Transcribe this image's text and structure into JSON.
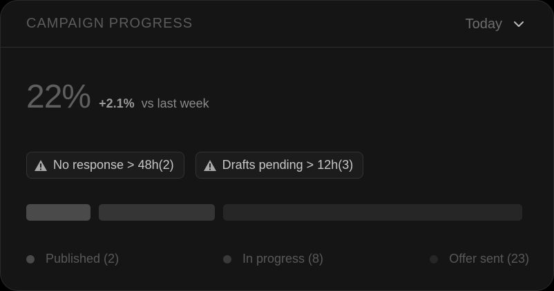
{
  "header": {
    "title": "CAMPAIGN PROGRESS",
    "period": "Today",
    "period_icon": "chevron-down-icon"
  },
  "metric": {
    "value": "22%",
    "delta": "+2.1%",
    "comparison": "vs last week"
  },
  "alerts": [
    {
      "icon": "warning-icon",
      "label": "No response > 48h(2)"
    },
    {
      "icon": "warning-icon",
      "label": "Drafts pending > 12h(3)"
    }
  ],
  "progress": {
    "segments": [
      {
        "name": "Published",
        "count": 2,
        "color": "#4a4a4a"
      },
      {
        "name": "In progress",
        "count": 8,
        "color": "#353535"
      },
      {
        "name": "Offer sent",
        "count": 23,
        "color": "#262626"
      }
    ]
  },
  "legend": [
    {
      "label": "Published (2)",
      "color": "#4a4a4a"
    },
    {
      "label": "In progress (8)",
      "color": "#3a3a3a"
    },
    {
      "label": "Offer sent (23)",
      "color": "#262626"
    }
  ]
}
